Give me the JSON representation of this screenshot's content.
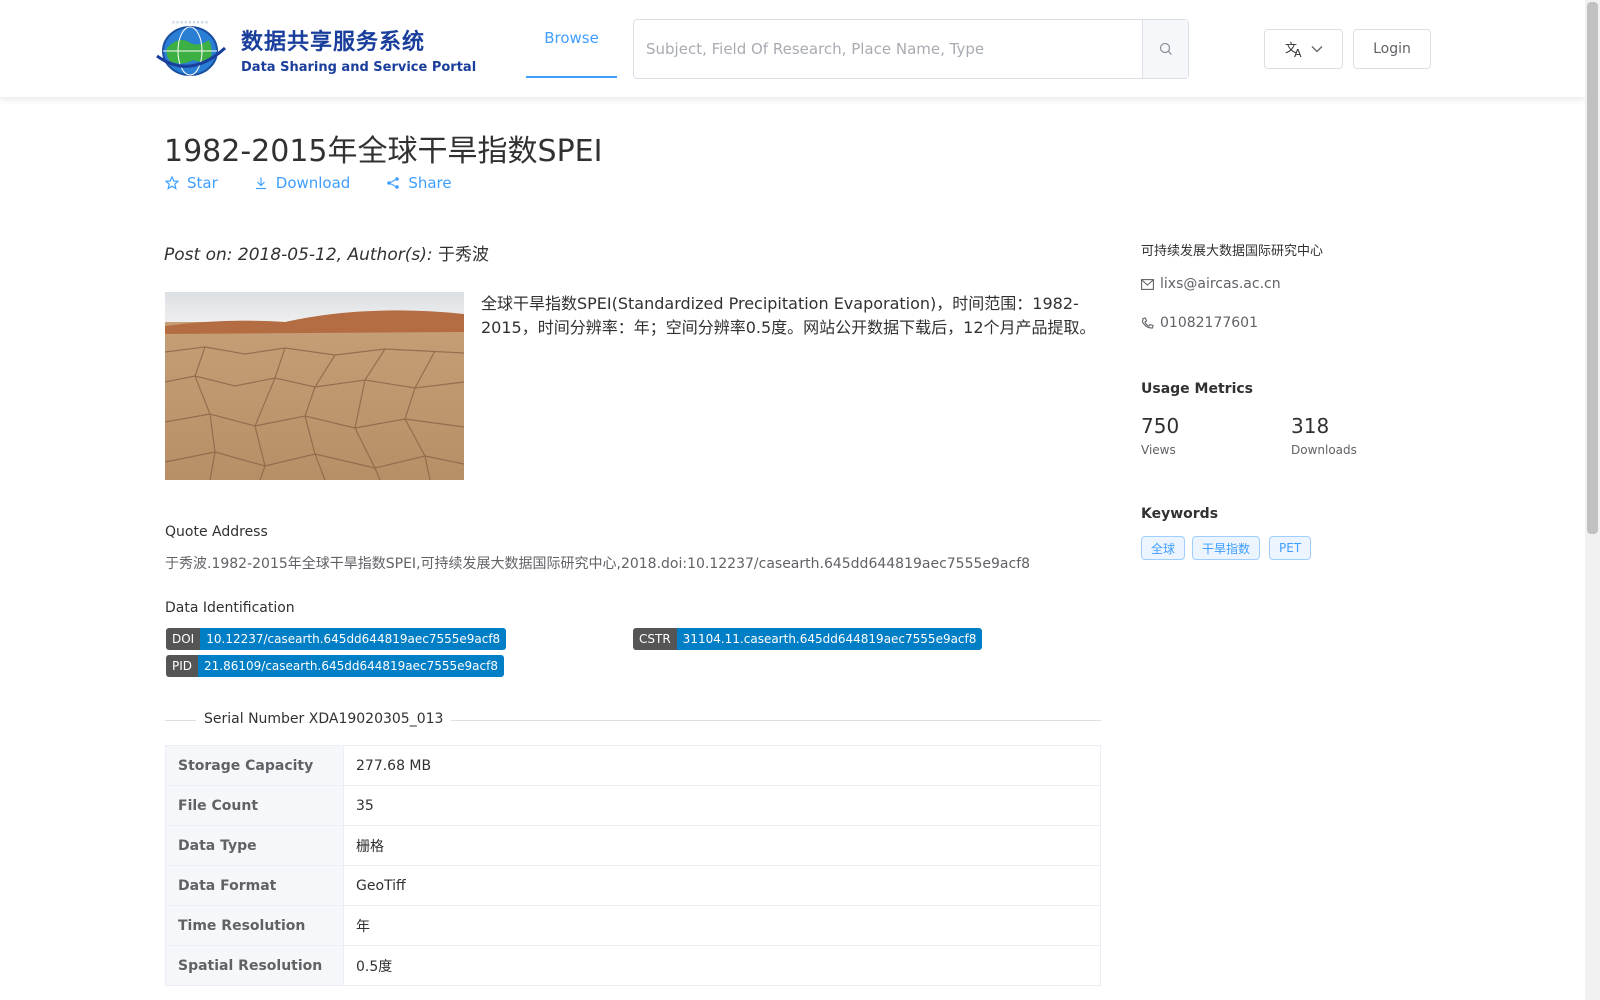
{
  "header": {
    "logo_cn": "数据共享服务系统",
    "logo_en": "Data Sharing and Service Portal",
    "nav_browse": "Browse",
    "search_placeholder": "Subject, Field Of Research, Place Name, Type",
    "login": "Login"
  },
  "dataset": {
    "title": "1982-2015年全球干旱指数SPEI",
    "actions": {
      "star": "Star",
      "download": "Download",
      "share": "Share"
    },
    "meta": "Post on: 2018-05-12, Author(s): ",
    "author": "于秀波",
    "description": "全球干旱指数SPEI(Standardized Precipitation Evaporation)，时间范围：1982-2015，时间分辨率：年；空间分辨率0.5度。网站公开数据下载后，12个月产品提取。"
  },
  "quote": {
    "label": "Quote Address",
    "text": "于秀波.1982-2015年全球干旱指数SPEI,可持续发展大数据国际研究中心,2018.doi:10.12237/casearth.645dd644819aec7555e9acf8"
  },
  "identification": {
    "label": "Data Identification",
    "doi_k": "DOI",
    "doi_v": "10.12237/casearth.645dd644819aec7555e9acf8",
    "cstr_k": "CSTR",
    "cstr_v": "31104.11.casearth.645dd644819aec7555e9acf8",
    "pid_k": "PID",
    "pid_v": "21.86109/casearth.645dd644819aec7555e9acf8"
  },
  "serial": "Serial Number XDA19020305_013",
  "table": [
    {
      "k": "Storage Capacity",
      "v": "277.68 MB"
    },
    {
      "k": "File Count",
      "v": "35"
    },
    {
      "k": "Data Type",
      "v": "栅格"
    },
    {
      "k": "Data Format",
      "v": "GeoTiff"
    },
    {
      "k": "Time Resolution",
      "v": "年"
    },
    {
      "k": "Spatial Resolution",
      "v": "0.5度"
    }
  ],
  "sidebar": {
    "org": "可持续发展大数据国际研究中心",
    "email": "lixs@aircas.ac.cn",
    "phone": "01082177601",
    "metrics_title": "Usage Metrics",
    "views": "750",
    "views_label": "Views",
    "downloads": "318",
    "downloads_label": "Downloads",
    "keywords_title": "Keywords",
    "keywords": [
      "全球",
      "干旱指数",
      "PET"
    ]
  }
}
